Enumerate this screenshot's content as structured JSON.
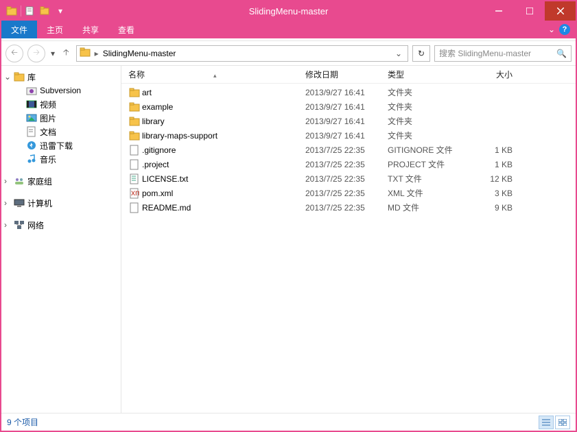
{
  "window": {
    "title": "SlidingMenu-master"
  },
  "ribbon": {
    "tabs": [
      "文件",
      "主页",
      "共享",
      "查看"
    ],
    "active": 0
  },
  "address": {
    "crumbs": [
      "SlidingMenu-master"
    ],
    "search_placeholder": "搜索 SlidingMenu-master"
  },
  "sidebar": {
    "root": {
      "label": "库",
      "expanded": true
    },
    "items": [
      {
        "label": "Subversion",
        "icon": "subversion"
      },
      {
        "label": "视频",
        "icon": "video"
      },
      {
        "label": "图片",
        "icon": "pictures"
      },
      {
        "label": "文档",
        "icon": "documents"
      },
      {
        "label": "迅雷下载",
        "icon": "xunlei"
      },
      {
        "label": "音乐",
        "icon": "music"
      }
    ],
    "groups": [
      {
        "label": "家庭组",
        "icon": "homegroup"
      },
      {
        "label": "计算机",
        "icon": "computer"
      },
      {
        "label": "网络",
        "icon": "network"
      }
    ]
  },
  "columns": {
    "name": "名称",
    "date": "修改日期",
    "type": "类型",
    "size": "大小"
  },
  "files": [
    {
      "name": "art",
      "date": "2013/9/27 16:41",
      "type": "文件夹",
      "size": "",
      "icon": "folder"
    },
    {
      "name": "example",
      "date": "2013/9/27 16:41",
      "type": "文件夹",
      "size": "",
      "icon": "folder"
    },
    {
      "name": "library",
      "date": "2013/9/27 16:41",
      "type": "文件夹",
      "size": "",
      "icon": "folder"
    },
    {
      "name": "library-maps-support",
      "date": "2013/9/27 16:41",
      "type": "文件夹",
      "size": "",
      "icon": "folder"
    },
    {
      "name": ".gitignore",
      "date": "2013/7/25 22:35",
      "type": "GITIGNORE 文件",
      "size": "1 KB",
      "icon": "file"
    },
    {
      "name": ".project",
      "date": "2013/7/25 22:35",
      "type": "PROJECT 文件",
      "size": "1 KB",
      "icon": "file"
    },
    {
      "name": "LICENSE.txt",
      "date": "2013/7/25 22:35",
      "type": "TXT 文件",
      "size": "12 KB",
      "icon": "txt"
    },
    {
      "name": "pom.xml",
      "date": "2013/7/25 22:35",
      "type": "XML 文件",
      "size": "3 KB",
      "icon": "xml"
    },
    {
      "name": "README.md",
      "date": "2013/7/25 22:35",
      "type": "MD 文件",
      "size": "9 KB",
      "icon": "file"
    }
  ],
  "status": {
    "text": "9 个项目"
  }
}
